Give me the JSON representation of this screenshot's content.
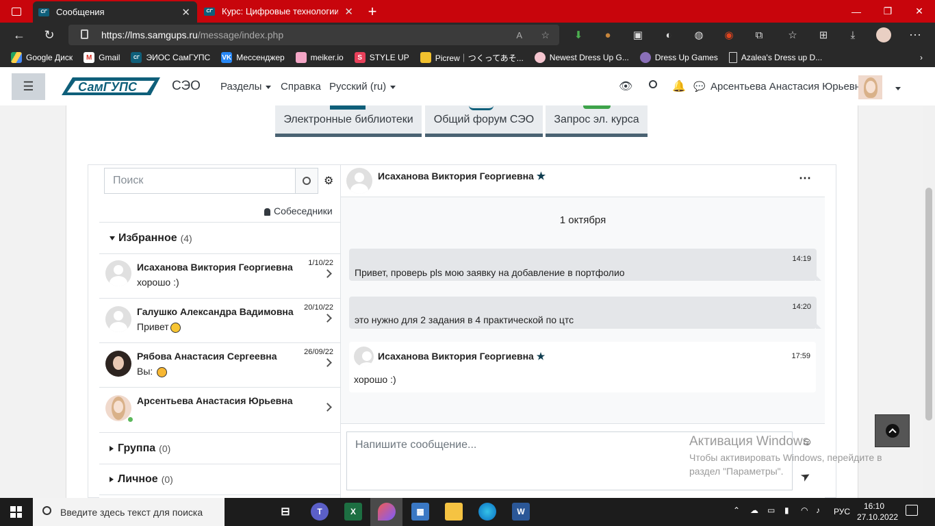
{
  "browser": {
    "tabs": [
      {
        "title": "Сообщения",
        "active": true
      },
      {
        "title": "Курс: Цифровые технологии са",
        "active": false
      }
    ],
    "url_host": "https://lms.samgups.ru",
    "url_path": "/message/index.php"
  },
  "bookmarks": [
    "Google Диск",
    "Gmail",
    "ЭИОС СамГУПС",
    "Мессенджер",
    "meiker.io",
    "STYLE UP",
    "Picrew｜つくってあそ...",
    "Newest Dress Up G...",
    "Dress Up Games",
    "Azalea's Dress up D..."
  ],
  "moodle": {
    "logo_text": "СамГУПС",
    "site": "СЭО",
    "nav": {
      "sections": "Разделы",
      "help": "Справка",
      "lang": "Русский (ru)"
    },
    "user": "Арсентьева Анастасия Юрьевна"
  },
  "blocks": [
    "Электронные библиотеки",
    "Общий форум СЭО",
    "Запрос эл. курса"
  ],
  "sidebar": {
    "search_placeholder": "Поиск",
    "contacts_link": "Собеседники",
    "favorites": {
      "label": "Избранное",
      "count": "(4)"
    },
    "group": {
      "label": "Группа",
      "count": "(0)"
    },
    "personal": {
      "label": "Личное",
      "count": "(0)"
    },
    "contacts": [
      {
        "name": "Исаханова Виктория Георгиевна",
        "message": "хорошо   :)",
        "date": "1/10/22"
      },
      {
        "name": "Галушко Александра Вадимовна",
        "message": "Привет",
        "date": "20/10/22"
      },
      {
        "name": "Рябова Анастасия Сергеевна",
        "message": "Вы:",
        "date": "26/09/22"
      },
      {
        "name": "Арсентьева Анастасия Юрьевна",
        "message": "",
        "date": ""
      }
    ]
  },
  "conversation": {
    "partner": "Исаханова Виктория Георгиевна",
    "date_label": "1 октября",
    "messages": [
      {
        "time": "14:19",
        "text": "Привет, проверь pls мою заявку на добавление в портфолио"
      },
      {
        "time": "14:20",
        "text": "это нужно для 2 задания в 4 практической по цтс"
      },
      {
        "time": "17:59",
        "text": "хорошо   :)",
        "author": "Исаханова Виктория Георгиевна"
      }
    ],
    "compose_placeholder": "Напишите сообщение..."
  },
  "watermark": {
    "title": "Активация Windows",
    "text": "Чтобы активировать Windows, перейдите в раздел \"Параметры\"."
  },
  "taskbar": {
    "search_placeholder": "Введите здесь текст для поиска",
    "lang": "РУС",
    "time": "16:10",
    "date": "27.10.2022"
  },
  "colors": {
    "browser_red": "#c8050c",
    "moodle_dark": "#0f5f7a",
    "block_border": "#4a6272"
  }
}
